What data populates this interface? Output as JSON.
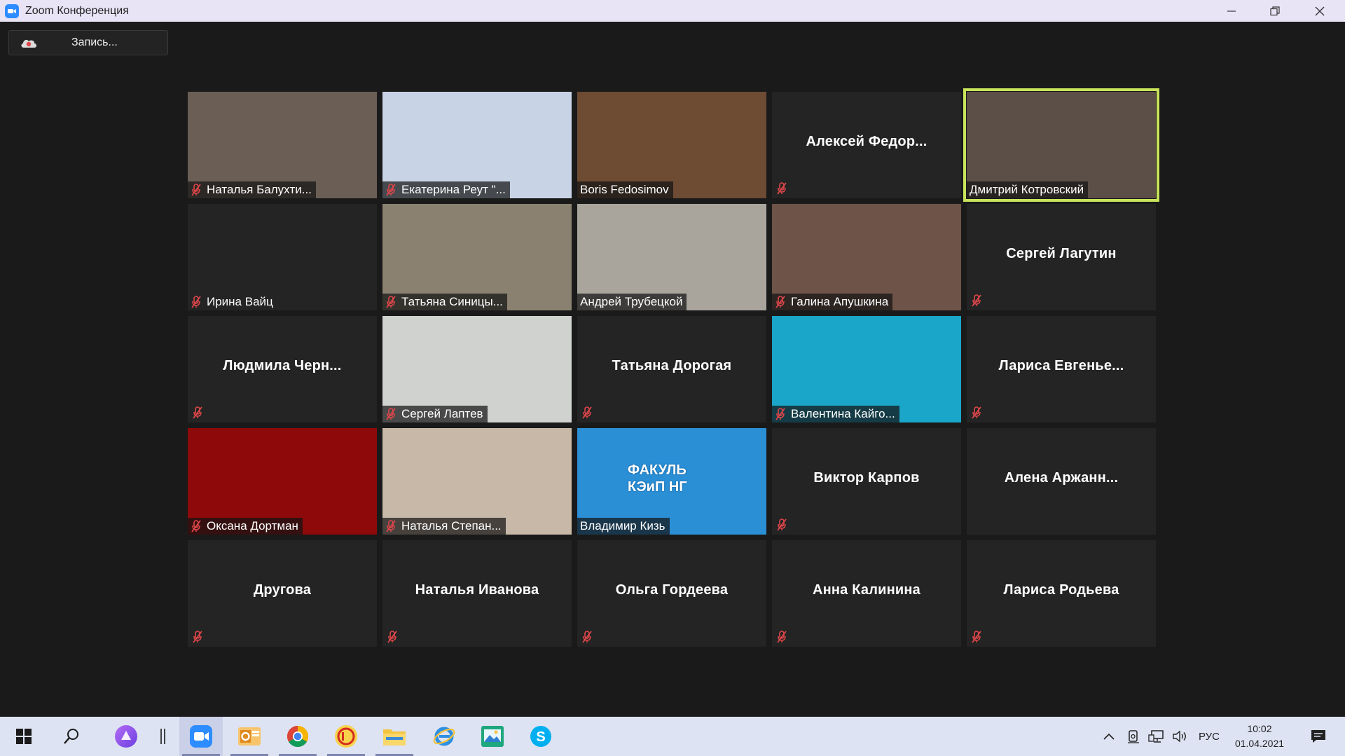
{
  "window": {
    "title": "Zoom Конференция"
  },
  "toolbar": {
    "record_label": "Запись..."
  },
  "participants": [
    {
      "name": "Наталья Балухти...",
      "video": true,
      "muted": true,
      "bg": "#6b5e55"
    },
    {
      "name": "Екатерина Реут \"...",
      "video": true,
      "muted": true,
      "bg": "#c9d3e6"
    },
    {
      "name": "Boris Fedosimov",
      "video": true,
      "muted": false,
      "bg": "#6e4b33"
    },
    {
      "name": "Алексей  Федор...",
      "video": false,
      "muted": true
    },
    {
      "name": "Дмитрий Котровский",
      "video": true,
      "muted": false,
      "active": true,
      "bg": "#5c4f47"
    },
    {
      "name": "Ирина Вайц",
      "video": false,
      "muted": true,
      "label_only": true
    },
    {
      "name": "Татьяна Синицы...",
      "video": true,
      "muted": true,
      "bg": "#8a8170"
    },
    {
      "name": "Андрей Трубецкой",
      "video": true,
      "muted": false,
      "bg": "#a9a59d"
    },
    {
      "name": "Галина Апушкина",
      "video": true,
      "muted": true,
      "bg": "#6e5448"
    },
    {
      "name": "Сергей Лагутин",
      "video": false,
      "muted": true
    },
    {
      "name": "Людмила  Черн...",
      "video": false,
      "muted": true
    },
    {
      "name": "Сергей Лаптев",
      "video": true,
      "muted": true,
      "bg": "#cfd2cf"
    },
    {
      "name": "Татьяна Дорогая",
      "video": false,
      "muted": true
    },
    {
      "name": "Валентина Кайго...",
      "video": true,
      "muted": true,
      "bg": "#1aa6c9"
    },
    {
      "name": "Лариса  Евгенье...",
      "video": false,
      "muted": true
    },
    {
      "name": "Оксана Дортман",
      "video": true,
      "muted": true,
      "bg": "#8e0a0a"
    },
    {
      "name": "Наталья Степан...",
      "video": true,
      "muted": true,
      "bg": "#c8b8a8"
    },
    {
      "name": "Владимир Кизь",
      "video": true,
      "muted": false,
      "bg": "#2b8fd6"
    },
    {
      "name": "Виктор Карпов",
      "video": false,
      "muted": true
    },
    {
      "name": "Алена  Аржанн...",
      "video": false,
      "muted": false
    },
    {
      "name": "Другова",
      "video": false,
      "muted": true
    },
    {
      "name": "Наталья Иванова",
      "video": false,
      "muted": true
    },
    {
      "name": "Ольга Гордеева",
      "video": false,
      "muted": true
    },
    {
      "name": "Анна Калинина",
      "video": false,
      "muted": true
    },
    {
      "name": "Лариса Родьева",
      "video": false,
      "muted": true
    }
  ],
  "slide_text": {
    "line1": "ФАКУЛЬ",
    "line2": "КЭиП НГ"
  },
  "taskbar": {
    "language": "РУС",
    "time": "10:02",
    "date": "01.04.2021"
  },
  "colors": {
    "active_speaker_border": "#c9e35a",
    "muted_mic": "#e0464a"
  }
}
